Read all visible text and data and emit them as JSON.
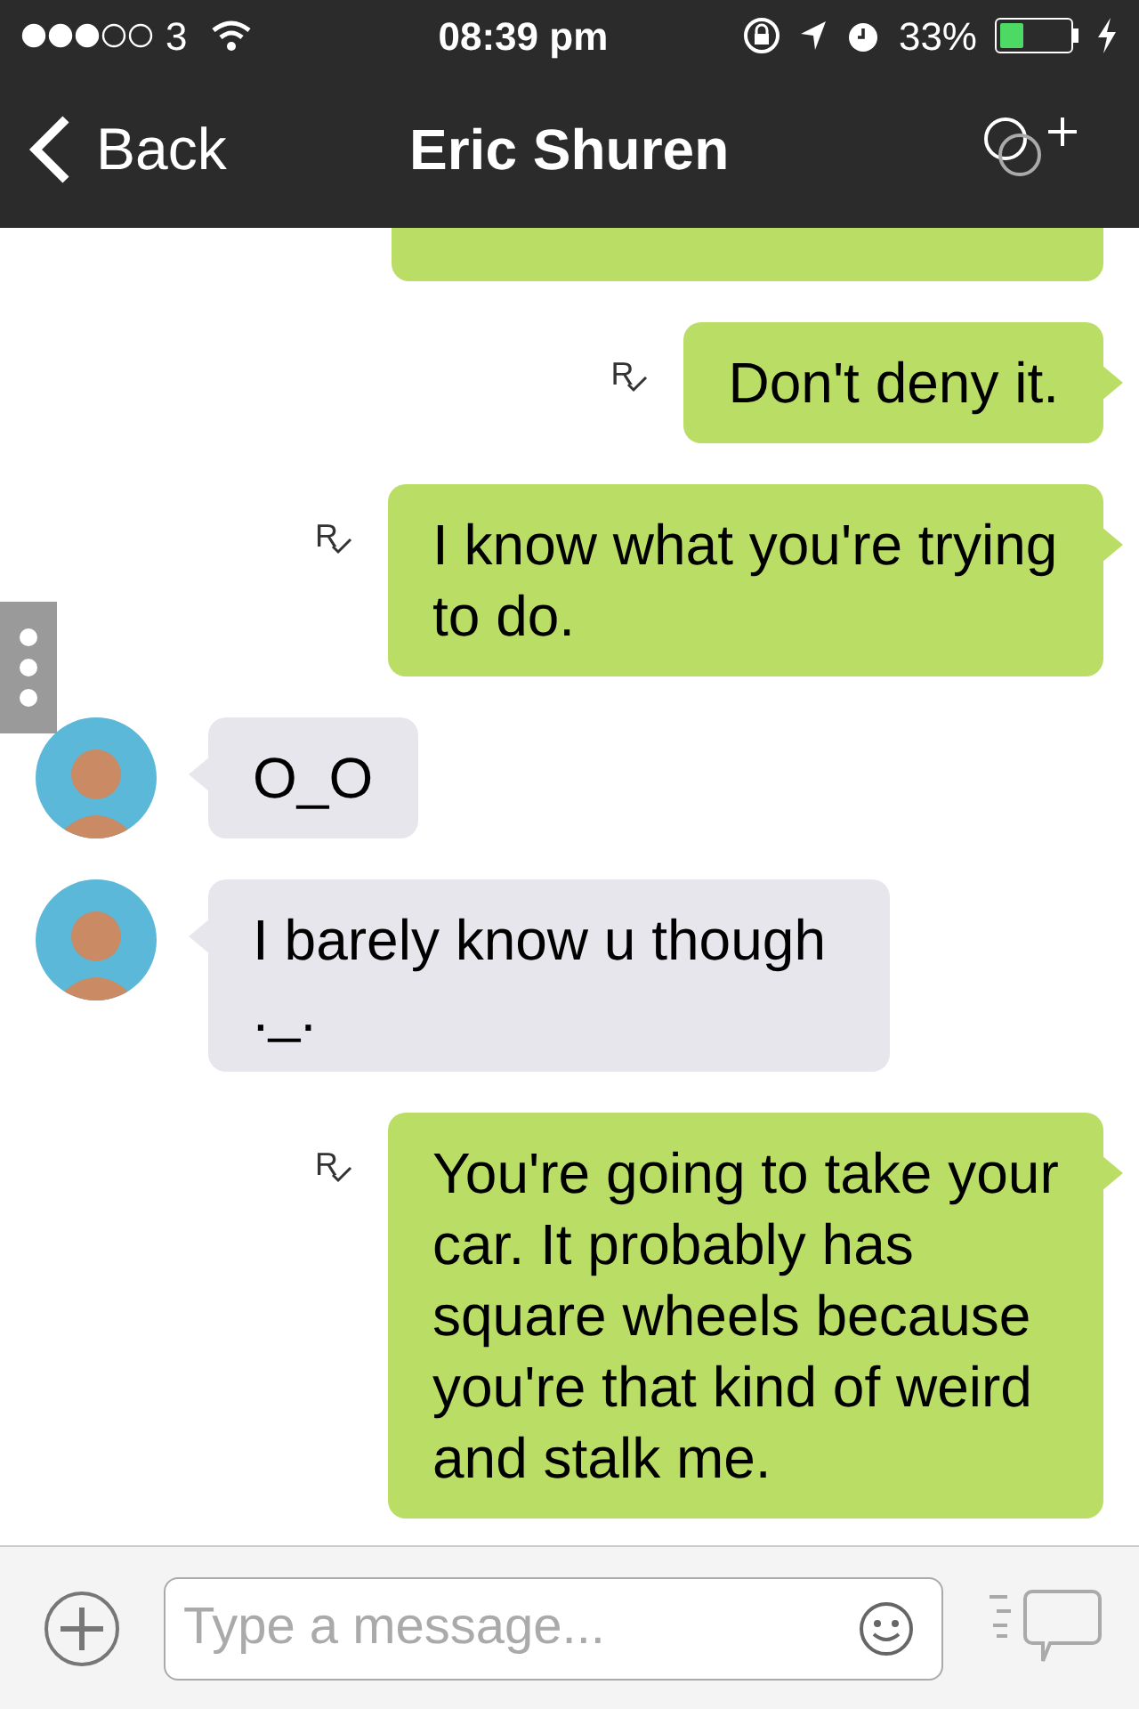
{
  "status_bar": {
    "carrier": "3",
    "time": "08:39 pm",
    "battery": "33%"
  },
  "nav": {
    "back": "Back",
    "title": "Eric Shuren"
  },
  "messages": [
    {
      "kind": "partial"
    },
    {
      "kind": "sent",
      "text": "Don't deny it.",
      "receipt": "R"
    },
    {
      "kind": "sent",
      "text": "I know what you're trying to do.",
      "receipt": "R"
    },
    {
      "kind": "received",
      "text": "O_O"
    },
    {
      "kind": "received",
      "text": "I barely know u though ._."
    },
    {
      "kind": "sent",
      "text": "You're going to take your car. It probably has square wheels because you're that kind of weird and stalk me.",
      "receipt": "R"
    }
  ],
  "composer": {
    "placeholder": "Type a message..."
  }
}
